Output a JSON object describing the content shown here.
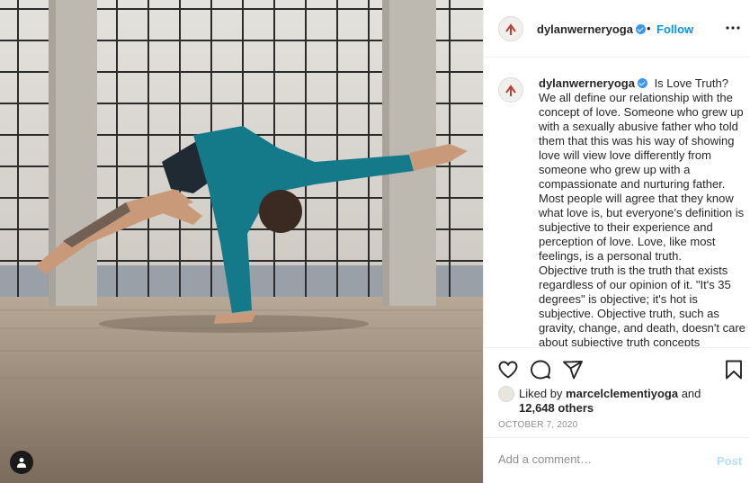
{
  "post": {
    "username": "dylanwerneryoga",
    "dot": "•",
    "follow_label": "Follow",
    "caption_lines": [
      "Is Love Truth?",
      "We all define our relationship with the concept of love. Someone who grew up with a sexually abusive father who told them that this was his way of showing love will view love differently from someone who grew up with a compassionate and nurturing father. Most people will agree that they know what love is, but everyone’s definition is subjective to their experience and perception of love. Love, like most feelings, is a personal truth.",
      "Objective truth is the truth that exists regardless of our opinion of it. \"It's 35 degrees\" is objective; it's hot is subjective. Objective truth, such as gravity, change, and death, doesn't care about subjective truth concepts"
    ],
    "liked_by_prefix": "Liked by",
    "liked_by_user": "marcelclementiyoga",
    "liked_by_and": "and",
    "likes_count": "12,648 others",
    "date": "OCTOBER 7, 2020",
    "comment_placeholder": "Add a comment…",
    "post_label": "Post"
  },
  "icons": {
    "verified": "verified-badge-icon",
    "more": "more-options-icon",
    "like": "heart-icon",
    "comment": "comment-bubble-icon",
    "share": "paper-plane-icon",
    "save": "bookmark-icon",
    "tagged": "user-tag-icon"
  },
  "colors": {
    "accent": "#0095f6",
    "post_disabled": "#b2dffc",
    "muted": "#8e8e8e",
    "shirt": "#147a8a"
  }
}
